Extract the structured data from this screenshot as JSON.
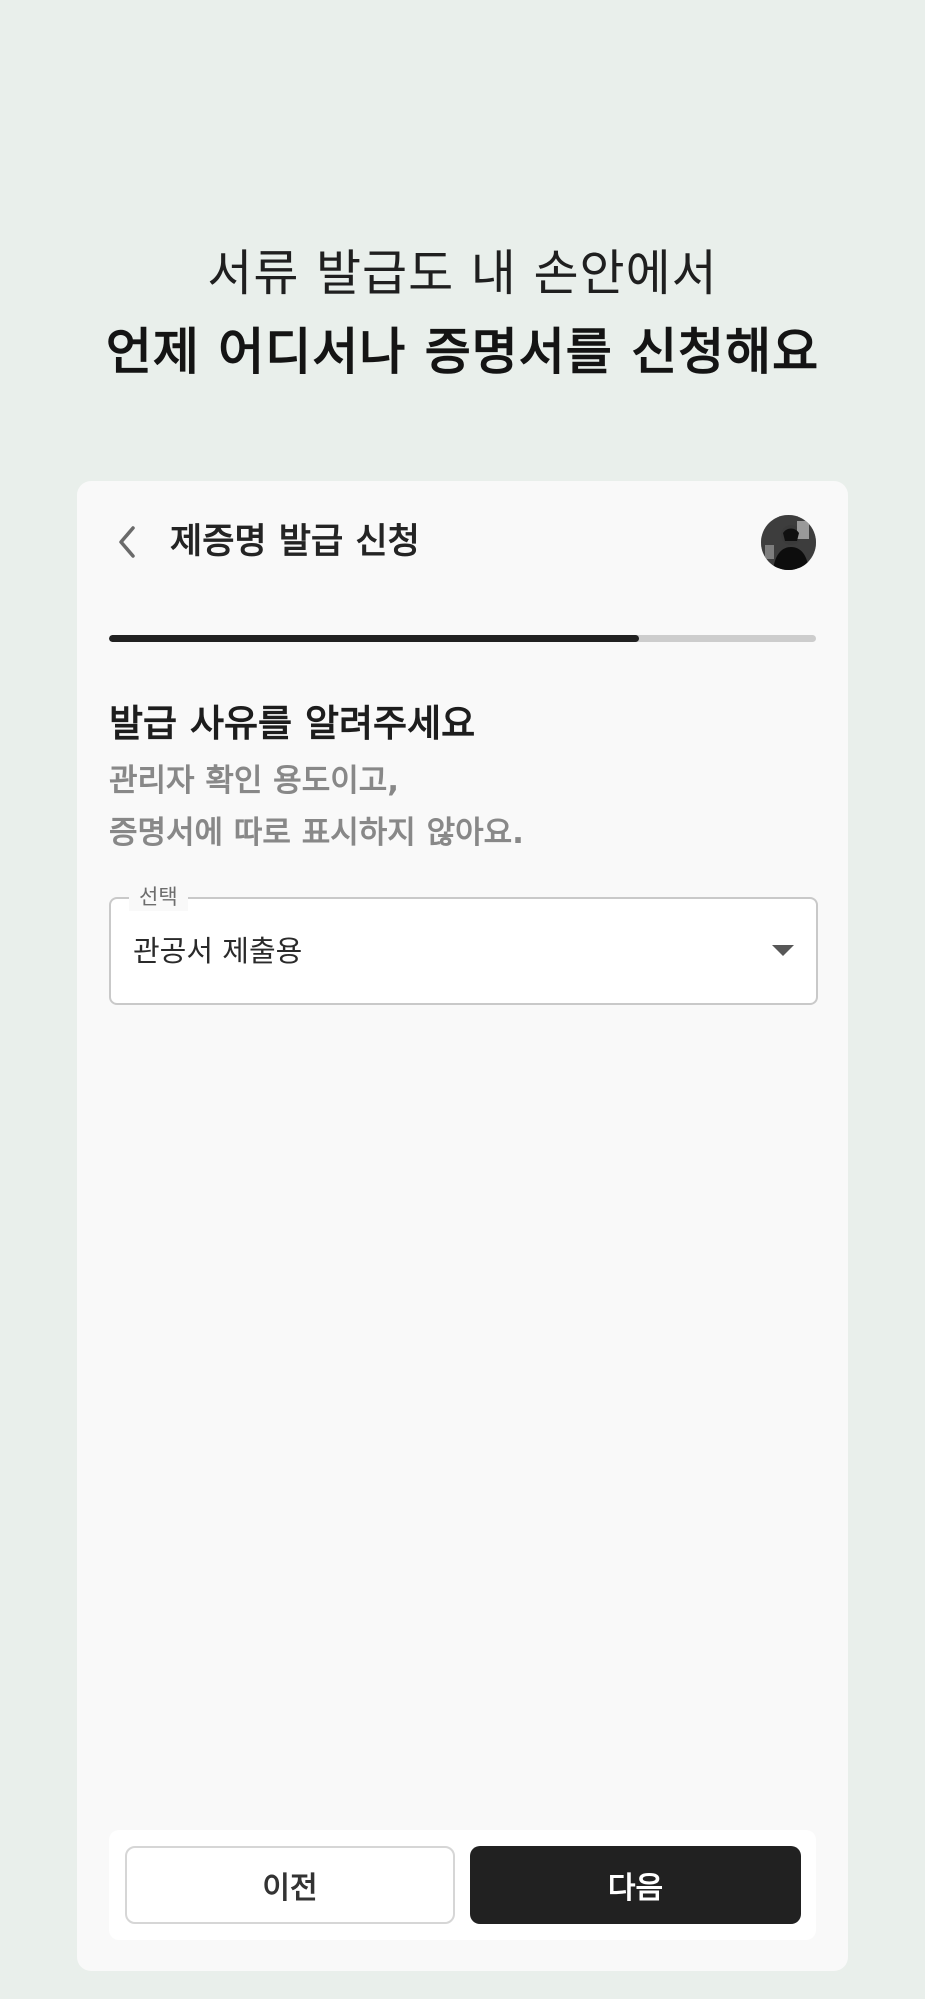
{
  "headline": {
    "line1": "서류 발급도 내 손안에서",
    "line2": "언제 어디서나 증명서를 신청해요"
  },
  "header": {
    "title": "제증명 발급 신청",
    "back_icon": "chevron-left-icon",
    "avatar_icon": "user-avatar"
  },
  "progress": {
    "fraction": 0.75
  },
  "question": {
    "title": "발급 사유를 알려주세요",
    "description_line1": "관리자 확인 용도이고,",
    "description_line2": "증명서에 따로 표시하지 않아요."
  },
  "select": {
    "legend": "선택",
    "value": "관공서 제출용",
    "caret_icon": "caret-down-icon"
  },
  "footer": {
    "prev_label": "이전",
    "next_label": "다음"
  },
  "colors": {
    "page_background": "#e9efeb",
    "card_background": "#f9f9f9",
    "primary_button": "#212121",
    "progress_fill": "#212121",
    "progress_track": "#cdcdcd",
    "muted_text": "#888888"
  }
}
